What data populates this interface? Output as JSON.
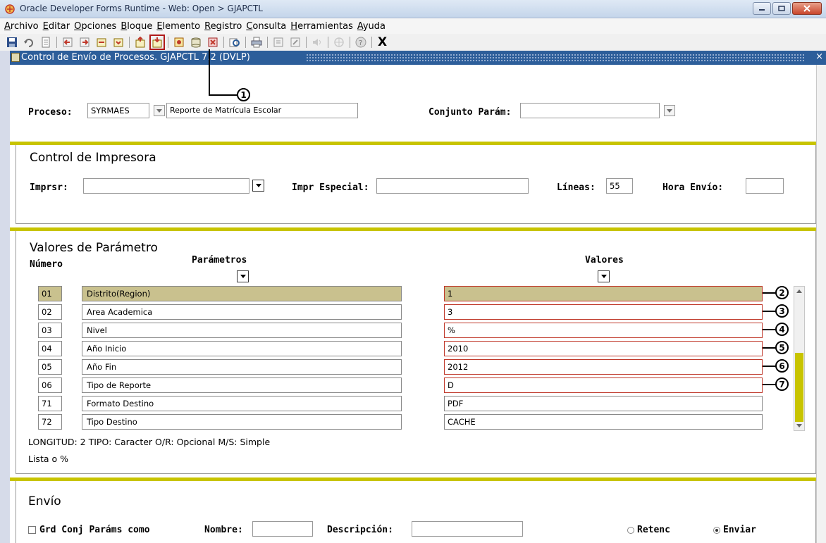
{
  "window": {
    "title": "Oracle Developer Forms Runtime - Web:  Open > GJAPCTL"
  },
  "menu": [
    {
      "acc": "A",
      "rest": "rchivo"
    },
    {
      "acc": "E",
      "rest": "ditar"
    },
    {
      "acc": "O",
      "rest": "pciones"
    },
    {
      "acc": "B",
      "rest": "loque"
    },
    {
      "acc": "E",
      "rest": "lemento"
    },
    {
      "acc": "R",
      "rest": "egistro"
    },
    {
      "acc": "C",
      "rest": "onsulta"
    },
    {
      "acc": "H",
      "rest": "erramientas"
    },
    {
      "acc": "A",
      "rest": "yuda"
    }
  ],
  "toolbar": {
    "exit_label": "X"
  },
  "form": {
    "title": "Control de Envío de Procesos.  GJAPCTL  7.2  (DVLP)",
    "close_label": "× "
  },
  "proceso": {
    "label": "Proceso:",
    "code": "SYRMAES",
    "description": "Reporte de Matrícula Escolar",
    "conjunto_label": "Conjunto Parám:",
    "conjunto_value": ""
  },
  "printer": {
    "title": "Control de Impresora",
    "imprsr_label": "Imprsr:",
    "imprsr_value": "",
    "impr_especial_label": "Impr Especial:",
    "impr_especial_value": "",
    "lineas_label": "Líneas:",
    "lineas_value": "55",
    "hora_label": "Hora Envío:",
    "hora_value": ""
  },
  "params": {
    "title": "Valores de Parámetro",
    "numero_header": "Número",
    "parametros_header": "Parámetros",
    "valores_header": "Valores",
    "rows": [
      {
        "num": "01",
        "name": "Distrito(Region)",
        "value": "1"
      },
      {
        "num": "02",
        "name": "Area Academica",
        "value": "3"
      },
      {
        "num": "03",
        "name": "Nivel",
        "value": "%"
      },
      {
        "num": "04",
        "name": "Año Inicio",
        "value": "2010"
      },
      {
        "num": "05",
        "name": "Año Fin",
        "value": "2012"
      },
      {
        "num": "06",
        "name": "Tipo de Reporte",
        "value": "D"
      },
      {
        "num": "71",
        "name": "Formato Destino",
        "value": "PDF"
      },
      {
        "num": "72",
        "name": "Tipo Destino",
        "value": "CACHE"
      }
    ],
    "hint1": "LONGITUD: 2 TIPO: Caracter O/R: Opcional M/S: Simple",
    "hint2": "Lista o %"
  },
  "callouts": [
    "1",
    "2",
    "3",
    "4",
    "5",
    "6",
    "7"
  ],
  "envio": {
    "title": "Envío",
    "grd_label": "Grd Conj Paráms como",
    "nombre_label": "Nombre:",
    "nombre_value": "",
    "descripcion_label": "Descripción:",
    "descripcion_value": "",
    "retenc_label": "Retenc",
    "enviar_label": "Enviar"
  }
}
